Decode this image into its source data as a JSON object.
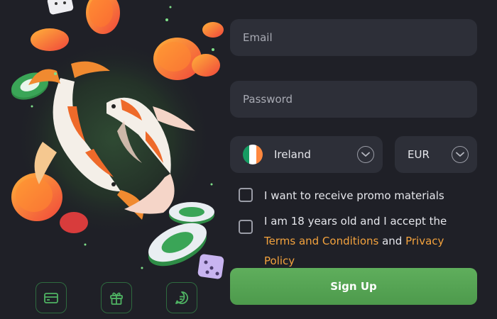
{
  "form": {
    "email_placeholder": "Email",
    "password_placeholder": "Password",
    "country": {
      "label": "Ireland",
      "flag_colors": [
        "#169b62",
        "#ffffff",
        "#ff883e"
      ]
    },
    "currency": {
      "label": "EUR"
    },
    "promo_label": "I want to receive promo materials",
    "terms": {
      "prefix": "I am 18 years old and I accept the ",
      "terms_link": "Terms and Conditions",
      "middle": " and ",
      "privacy_link": "Privacy Policy"
    },
    "signup_label": "Sign Up"
  },
  "features": [
    {
      "icon": "credit-card-icon"
    },
    {
      "icon": "gift-icon"
    },
    {
      "icon": "chat-icon"
    }
  ],
  "colors": {
    "background": "#1f2027",
    "field": "#2d2f38",
    "accent_link": "#f3a23d",
    "button": "#56a454"
  }
}
